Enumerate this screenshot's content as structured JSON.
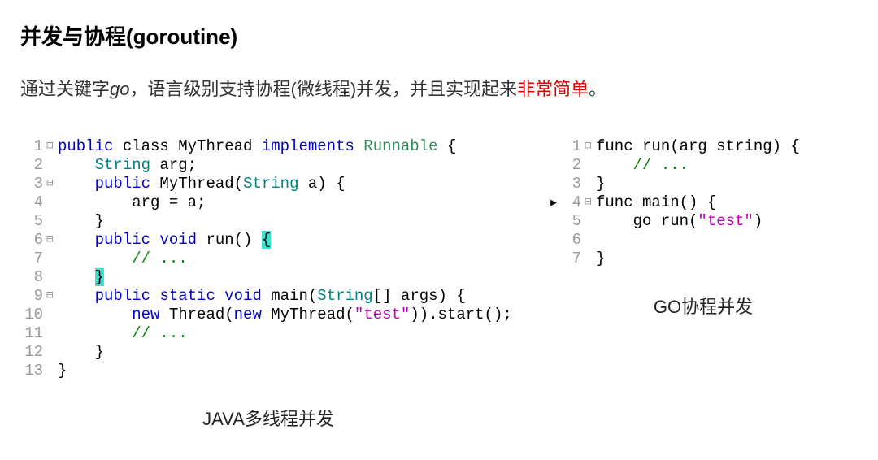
{
  "title": "并发与协程(goroutine)",
  "desc": {
    "p1": "通过关键字",
    "keyword": "go",
    "p2": "，语言级别支持协程(微线程)并发，并且实现起来",
    "highlight": "非常简单",
    "p3": "。"
  },
  "java": {
    "caption": "JAVA多线程并发",
    "lines": [
      {
        "n": "1",
        "f": "⊟",
        "arr": "",
        "segs": [
          {
            "t": "public",
            "c": "kw"
          },
          {
            "t": " class MyThread "
          },
          {
            "t": "implements",
            "c": "kw"
          },
          {
            "t": " "
          },
          {
            "t": "Runnable",
            "c": "rn"
          },
          {
            "t": " {"
          }
        ]
      },
      {
        "n": "2",
        "f": "",
        "arr": "",
        "segs": [
          {
            "t": "    "
          },
          {
            "t": "String",
            "c": "type"
          },
          {
            "t": " arg;"
          }
        ]
      },
      {
        "n": "3",
        "f": "⊟",
        "arr": "",
        "segs": [
          {
            "t": "    "
          },
          {
            "t": "public",
            "c": "kw"
          },
          {
            "t": " MyThread("
          },
          {
            "t": "String",
            "c": "type"
          },
          {
            "t": " a) {"
          }
        ]
      },
      {
        "n": "4",
        "f": "",
        "arr": "",
        "segs": [
          {
            "t": "        arg = a;"
          }
        ]
      },
      {
        "n": "5",
        "f": "",
        "arr": "",
        "segs": [
          {
            "t": "    }"
          }
        ]
      },
      {
        "n": "6",
        "f": "⊟",
        "arr": "",
        "segs": [
          {
            "t": "    "
          },
          {
            "t": "public",
            "c": "kw"
          },
          {
            "t": " "
          },
          {
            "t": "void",
            "c": "kw"
          },
          {
            "t": " run() "
          },
          {
            "t": "{",
            "c": "hl-bg"
          }
        ]
      },
      {
        "n": "7",
        "f": "",
        "arr": "",
        "segs": [
          {
            "t": "        "
          },
          {
            "t": "// ...",
            "c": "cm"
          }
        ]
      },
      {
        "n": "8",
        "f": "",
        "arr": "",
        "segs": [
          {
            "t": "    "
          },
          {
            "t": "}",
            "c": "hl-bg"
          }
        ]
      },
      {
        "n": "9",
        "f": "⊟",
        "arr": "",
        "segs": [
          {
            "t": "    "
          },
          {
            "t": "public",
            "c": "kw"
          },
          {
            "t": " "
          },
          {
            "t": "static",
            "c": "kw"
          },
          {
            "t": " "
          },
          {
            "t": "void",
            "c": "kw"
          },
          {
            "t": " main("
          },
          {
            "t": "String",
            "c": "type"
          },
          {
            "t": "[] args) {"
          }
        ]
      },
      {
        "n": "10",
        "f": "",
        "arr": "",
        "segs": [
          {
            "t": "        "
          },
          {
            "t": "new",
            "c": "kw"
          },
          {
            "t": " Thread("
          },
          {
            "t": "new",
            "c": "kw"
          },
          {
            "t": " MyThread("
          },
          {
            "t": "\"test\"",
            "c": "str"
          },
          {
            "t": ")).start();"
          }
        ]
      },
      {
        "n": "11",
        "f": "",
        "arr": "",
        "segs": [
          {
            "t": "        "
          },
          {
            "t": "// ...",
            "c": "cm"
          }
        ]
      },
      {
        "n": "12",
        "f": "",
        "arr": "",
        "segs": [
          {
            "t": "    }"
          }
        ]
      },
      {
        "n": "13",
        "f": "",
        "arr": "",
        "segs": [
          {
            "t": "}"
          }
        ]
      }
    ]
  },
  "go": {
    "caption": "GO协程并发",
    "lines": [
      {
        "n": "1",
        "f": "⊟",
        "arr": "",
        "segs": [
          {
            "t": "func run(arg string) {"
          }
        ]
      },
      {
        "n": "2",
        "f": "",
        "arr": "",
        "segs": [
          {
            "t": "    "
          },
          {
            "t": "// ...",
            "c": "cm"
          }
        ]
      },
      {
        "n": "3",
        "f": "",
        "arr": "",
        "segs": [
          {
            "t": "}"
          }
        ]
      },
      {
        "n": "4",
        "f": "⊟",
        "arr": "▶",
        "segs": [
          {
            "t": "func main() {"
          }
        ]
      },
      {
        "n": "5",
        "f": "",
        "arr": "",
        "segs": [
          {
            "t": "    go run("
          },
          {
            "t": "\"test\"",
            "c": "str"
          },
          {
            "t": ")"
          }
        ]
      },
      {
        "n": "6",
        "f": "",
        "arr": "",
        "segs": [
          {
            "t": "    "
          }
        ]
      },
      {
        "n": "7",
        "f": "",
        "arr": "",
        "segs": [
          {
            "t": "}"
          }
        ]
      }
    ]
  }
}
